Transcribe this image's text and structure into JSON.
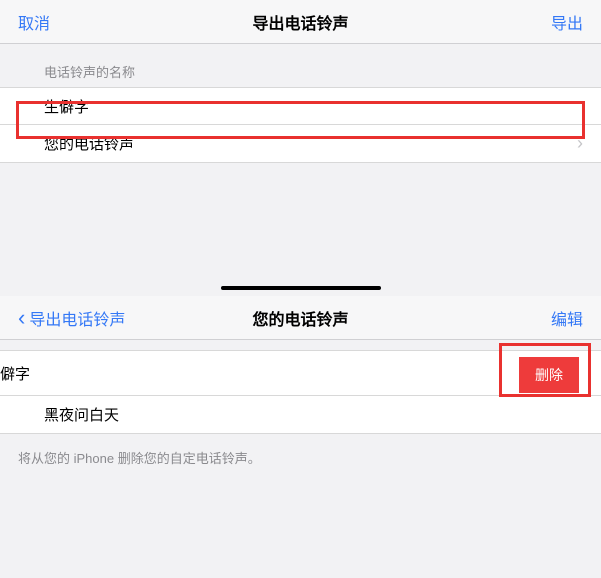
{
  "screen1": {
    "nav": {
      "cancel": "取消",
      "title": "导出电话铃声",
      "export": "导出"
    },
    "section_header": "电话铃声的名称",
    "ringtone_name": "生僻字",
    "your_ringtone": "您的电话铃声",
    "chevron": "›"
  },
  "screen2": {
    "nav": {
      "back_chevron": "‹",
      "back": "导出电话铃声",
      "title": "您的电话铃声",
      "edit": "编辑"
    },
    "swipe_item": "僻字",
    "delete_label": "删除",
    "second_item": "黑夜问白天",
    "footer": "将从您的 iPhone 删除您的自定电话铃声。"
  }
}
